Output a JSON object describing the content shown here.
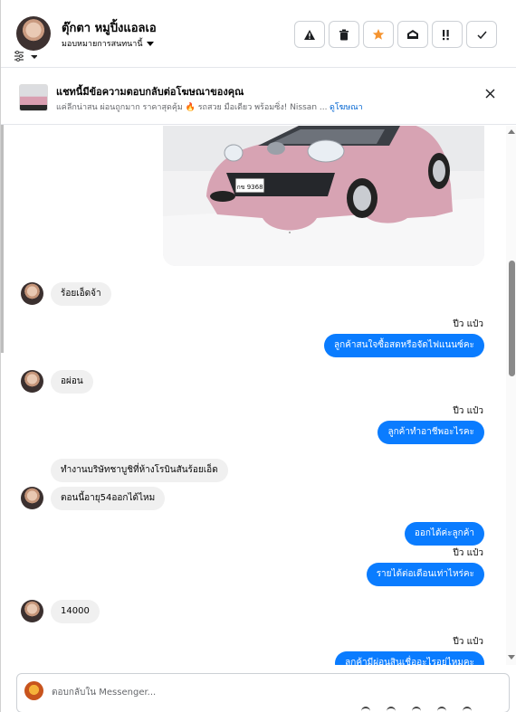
{
  "header": {
    "contact_name": "ตุ๊กตา หมูปิ้งแอลเอ",
    "assign_label": "มอบหมายการสนทนานี้",
    "actions": [
      "warning-icon",
      "trash-icon",
      "star-icon",
      "mark-read-icon",
      "follow-up-icon",
      "done-icon"
    ]
  },
  "ad": {
    "title": "แชทนี้มีข้อความตอบกลับต่อโฆษณาของคุณ",
    "subtitle": "แค่ลีกน่าสน ผ่อนถูกมาก ราคาสุดคุ้ม 🔥 รถสวย มือเดียว พร้อมซิ่ง! Nissan ...",
    "link": "ดูโฆษณา"
  },
  "messages": [
    {
      "side": "in",
      "text": "ร้อยเอ็ดจ้า"
    },
    {
      "side": "out",
      "sender": "ปีว แป๋ว",
      "text": "ลูกค้าสนใจซื้อสดหรือจัดไฟแนนซ์คะ"
    },
    {
      "side": "in",
      "text": "อผ่อน"
    },
    {
      "side": "out",
      "sender": "ปีว แป๋ว",
      "text": "ลูกค้าทำอาชีพอะไรคะ"
    },
    {
      "side": "in",
      "text": "ทำงานบริษัทชาบูชิที่ห้างโรบินสันร้อยเอ็ด"
    },
    {
      "side": "in",
      "text": "ตอนนี้อายุ54ออกได้ไหม"
    },
    {
      "side": "out",
      "text": "ออกได้ค่ะลูกค้า"
    },
    {
      "side": "out",
      "sender": "ปีว แป๋ว",
      "text": "รายได้ต่อเดือนเท่าไหร่คะ"
    },
    {
      "side": "in",
      "text": "14000"
    },
    {
      "side": "out",
      "sender": "ปีว แป๋ว",
      "text": "ลูกค้ามีผ่อนสินเชื่ออะไรอยู่ไหมคะ"
    }
  ],
  "car_plate": "กข 9368",
  "composer": {
    "placeholder": "ตอบกลับใน Messenger..."
  },
  "colors": {
    "outgoing_bubble": "#0a7cff",
    "incoming_bubble": "#f0f0f0",
    "star": "#f5932f",
    "link": "#0064d1"
  }
}
